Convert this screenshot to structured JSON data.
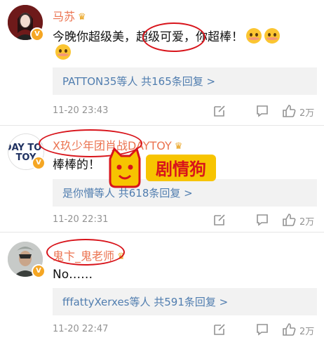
{
  "colors": {
    "username": "#eb7350",
    "link": "#507daf",
    "meta": "#939393",
    "highlight": "#d8141b",
    "reply_bg": "#f2f2f2"
  },
  "comments": [
    {
      "username": "马苏",
      "text": "今晚你超级美，超级可爱，你超棒！",
      "reply": "PATTON35等人  共165条回复 >",
      "time": "11-20 23:43",
      "likes": "2万"
    },
    {
      "username": "X玖少年团肖战DAYTOY",
      "text": "棒棒的！",
      "avatar_text": "DAY TOY",
      "reply": "是你懵等人  共618条回复 >",
      "time": "11-20 22:31",
      "likes": "2万"
    },
    {
      "username": "鬼卞_鬼老师",
      "text": "No……",
      "reply": "fffattyXerxes等人  共591条回复 >",
      "time": "11-20 22:47",
      "likes": "2万"
    }
  ],
  "watermark": {
    "text": "剧情狗"
  },
  "icons": [
    "vip-badge-icon",
    "crown-icon",
    "emoji-icon",
    "share-icon",
    "comment-icon",
    "like-icon"
  ]
}
